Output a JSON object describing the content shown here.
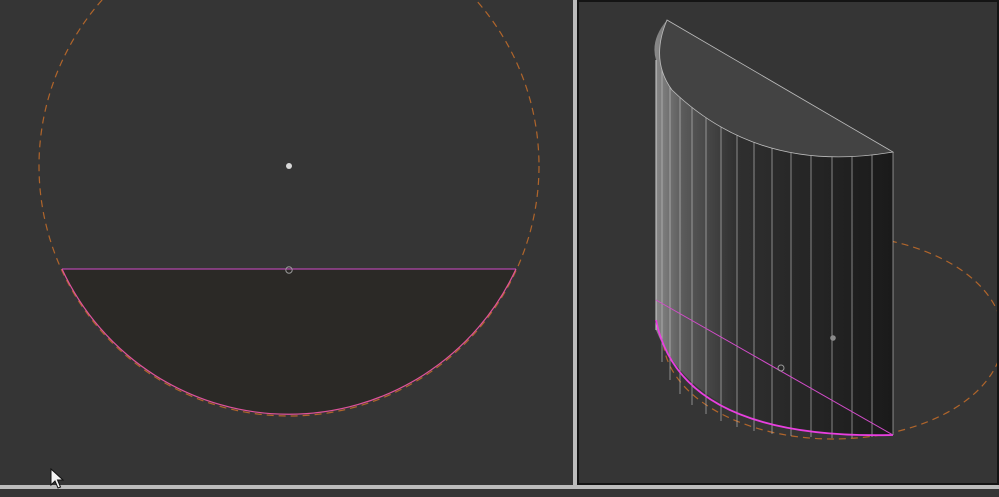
{
  "viewports": {
    "top_view": {
      "label": "top-view-viewport"
    },
    "perspective_view": {
      "label": "perspective-viewport"
    }
  },
  "colors": {
    "background": "#353535",
    "construction_circle": "#b0652b",
    "selection_edge": "#e93fe0",
    "segment_fill": "#2b2926",
    "solid_face_top": "#434343",
    "solid_face_side": "#1e1e1e",
    "splitter": "#bcbcbc",
    "active_border": "#141414"
  },
  "icons": {
    "cursor": "arrow-cursor-icon",
    "center_point": "point-icon",
    "midpoint": "midpoint-icon"
  }
}
